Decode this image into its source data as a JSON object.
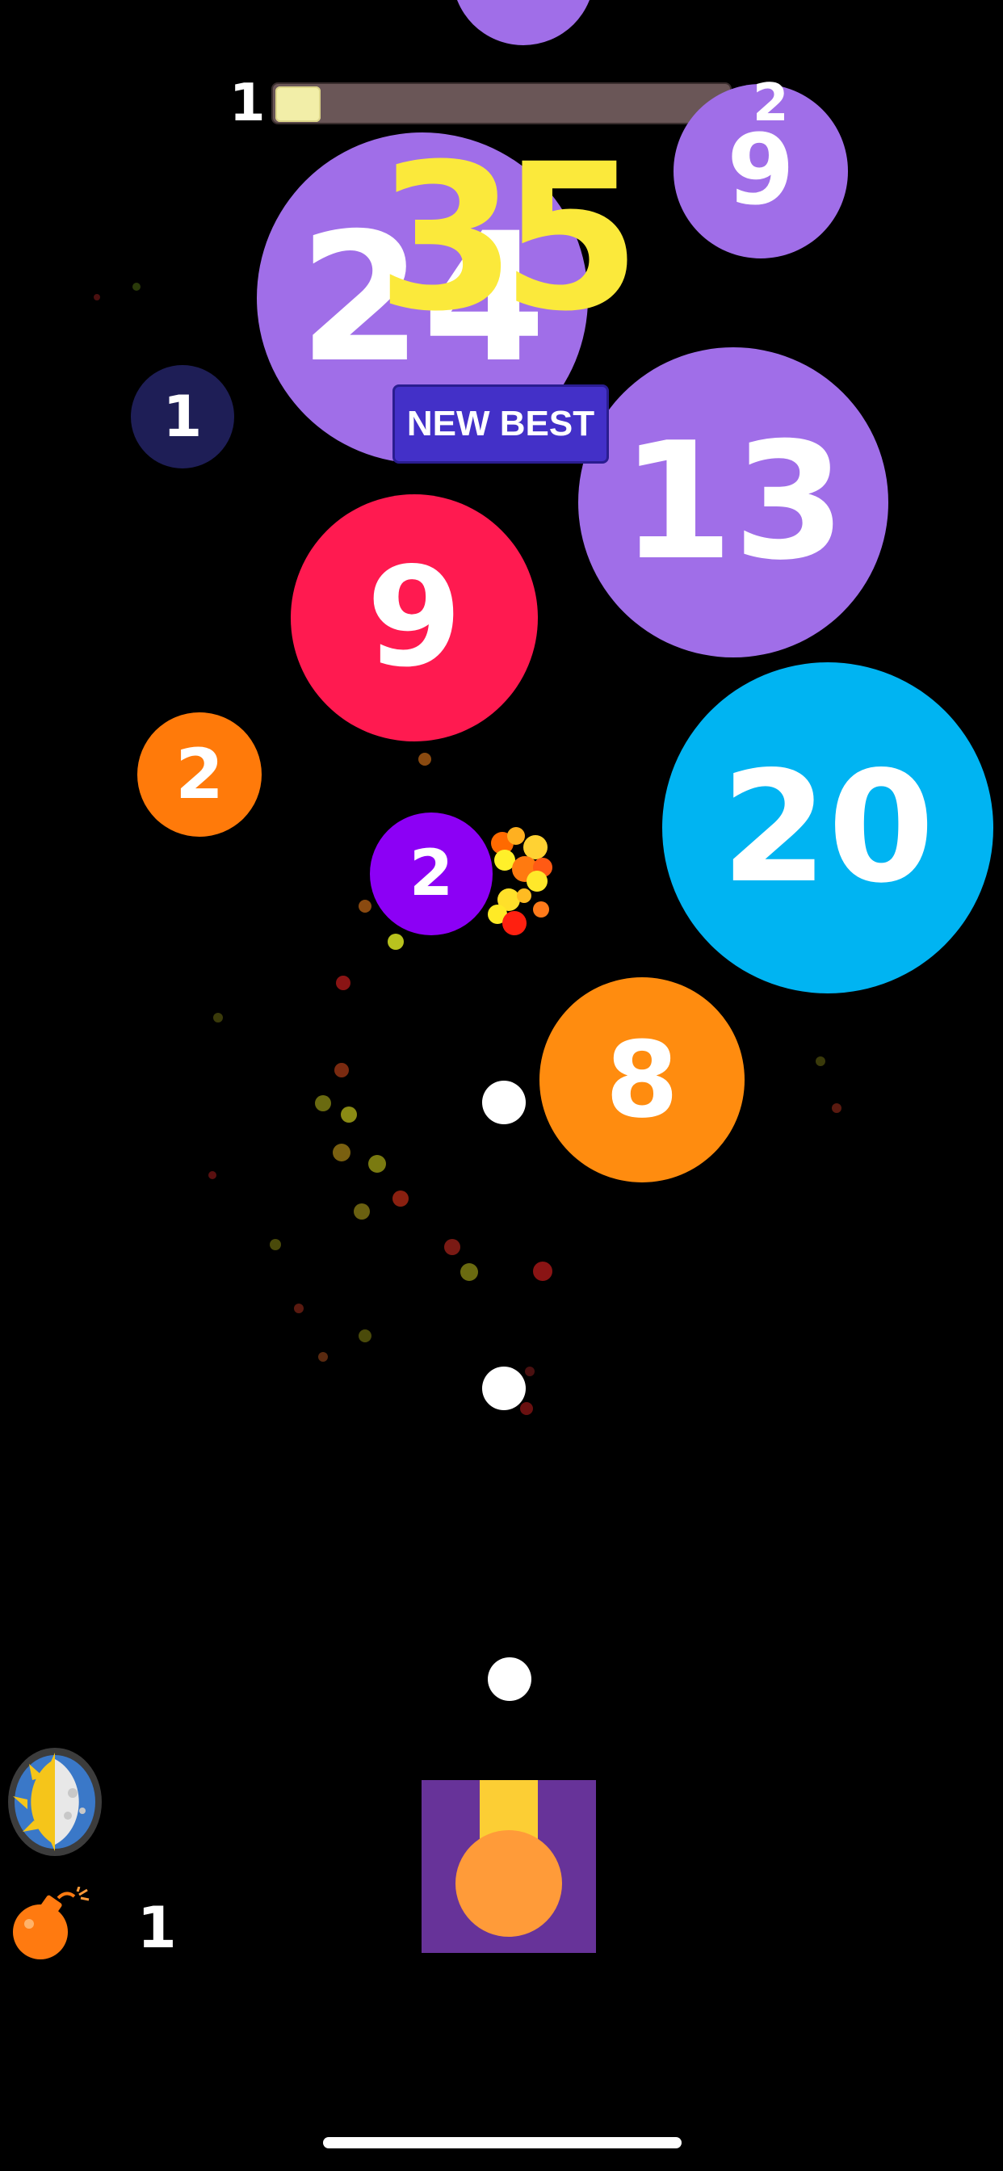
{
  "hud": {
    "level_current": "1",
    "level_next": "2",
    "progress_fraction": 0.1,
    "score": "35",
    "new_best_label": "NEW BEST"
  },
  "balls": [
    {
      "value": "24",
      "color": "#a06ee8"
    },
    {
      "value": "9",
      "color": "#a06ee8"
    },
    {
      "value": "1",
      "color": "#1e1e56"
    },
    {
      "value": "13",
      "color": "#a06ee8"
    },
    {
      "value": "9",
      "color": "#ff1a50"
    },
    {
      "value": "2",
      "color": "#ff7a0a"
    },
    {
      "value": "20",
      "color": "#00b4f2"
    },
    {
      "value": "2",
      "color": "#8c00f5"
    },
    {
      "value": "8",
      "color": "#ff8c0f"
    }
  ],
  "powerups": {
    "day_night_icon": "day-night-icon",
    "bomb_icon": "bomb-icon",
    "bomb_count": "1"
  },
  "colors": {
    "background": "#000000",
    "score": "#fbe93b",
    "new_best_bg": "#4330c8",
    "cannon_body": "#673399",
    "cannon_barrel": "#fcce34",
    "cannon_ball": "#ff9b39"
  }
}
